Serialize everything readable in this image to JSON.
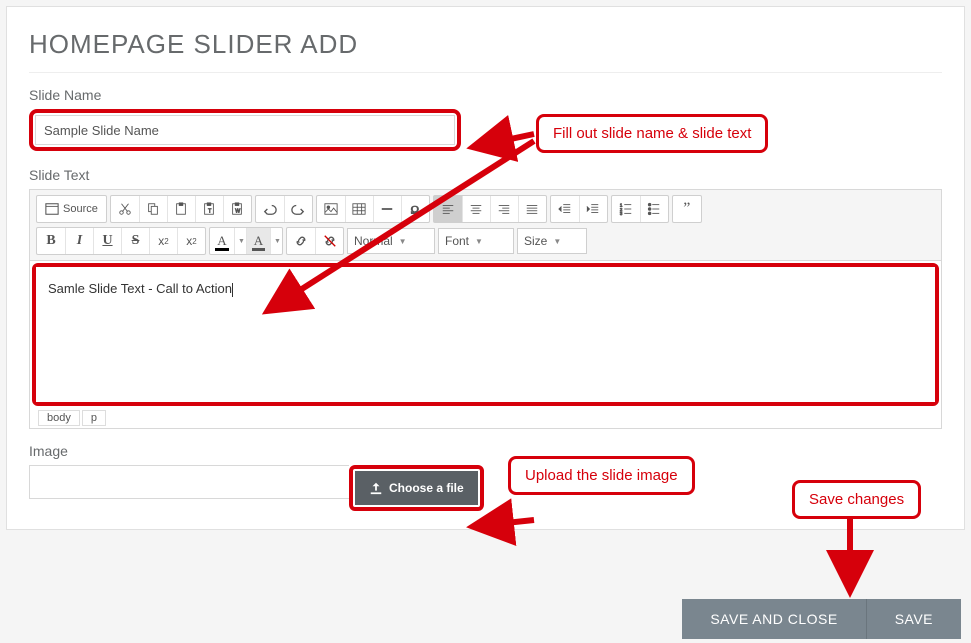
{
  "page": {
    "title": "HOMEPAGE SLIDER ADD"
  },
  "fields": {
    "slide_name": {
      "label": "Slide Name",
      "value": "Sample Slide Name"
    },
    "slide_text": {
      "label": "Slide Text",
      "content": "Samle Slide Text - Call to Action"
    },
    "image": {
      "label": "Image",
      "choose_label": "Choose a file"
    }
  },
  "editor": {
    "source_label": "Source",
    "style_select": {
      "value": "Normal"
    },
    "font_select": {
      "value": "Font"
    },
    "size_select": {
      "value": "Size"
    },
    "path": [
      "body",
      "p"
    ]
  },
  "actions": {
    "save_close": "SAVE AND CLOSE",
    "save": "SAVE"
  },
  "annotations": {
    "top": "Fill out slide name & slide text",
    "mid": "Upload the slide image",
    "right": "Save changes"
  }
}
